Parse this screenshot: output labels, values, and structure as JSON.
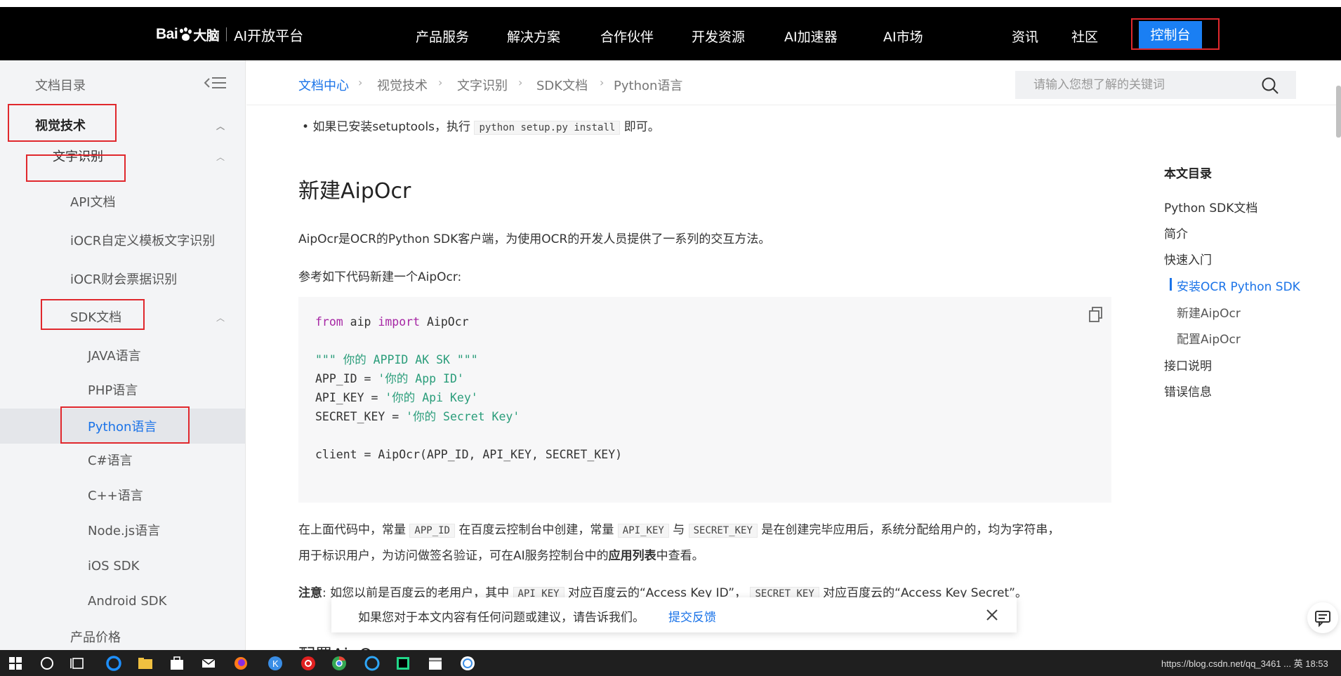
{
  "header": {
    "logo_text": "Bai",
    "logo_suffix": "大脑",
    "platform": "AI开放平台",
    "nav": [
      "产品服务",
      "解决方案",
      "合作伙伴",
      "开发资源",
      "AI加速器",
      "AI市场"
    ],
    "right_nav": [
      "资讯",
      "社区"
    ],
    "console_label": "控制台"
  },
  "sidebar": {
    "title": "文档目录",
    "items": [
      {
        "label": "视觉技术"
      },
      {
        "label": "文字识别"
      },
      {
        "label": "API文档"
      },
      {
        "label": "iOCR自定义模板文字识别"
      },
      {
        "label": "iOCR财会票据识别"
      },
      {
        "label": "SDK文档"
      },
      {
        "label": "JAVA语言"
      },
      {
        "label": "PHP语言"
      },
      {
        "label": "Python语言"
      },
      {
        "label": "C#语言"
      },
      {
        "label": "C++语言"
      },
      {
        "label": "Node.js语言"
      },
      {
        "label": "iOS SDK"
      },
      {
        "label": "Android SDK"
      },
      {
        "label": "产品价格"
      }
    ]
  },
  "breadcrumb": [
    "文档中心",
    "视觉技术",
    "文字识别",
    "SDK文档",
    "Python语言"
  ],
  "search": {
    "placeholder": "请输入您想了解的关键词"
  },
  "content": {
    "bullet_prefix": "如果已安装setuptools，执行",
    "bullet_code": "python setup.py install",
    "bullet_suffix": "即可。",
    "heading": "新建AipOcr",
    "intro": "AipOcr是OCR的Python SDK客户端，为使用OCR的开发人员提供了一系列的交互方法。",
    "ref": "参考如下代码新建一个AipOcr:",
    "code": {
      "l1_kw1": "from",
      "l1_mid": " aip ",
      "l1_kw2": "import",
      "l1_end": " AipOcr",
      "l3": "\"\"\" 你的 APPID AK SK \"\"\"",
      "l4_a": "APP_ID = ",
      "l4_b": "'你的 App ID'",
      "l5_a": "API_KEY = ",
      "l5_b": "'你的 Api Key'",
      "l6_a": "SECRET_KEY = ",
      "l6_b": "'你的 Secret Key'",
      "l8": "client = AipOcr(APP_ID, API_KEY, SECRET_KEY)"
    },
    "desc_1": "在上面代码中，常量",
    "desc_c1": "APP_ID",
    "desc_2": "在百度云控制台中创建，常量",
    "desc_c2": "API_KEY",
    "desc_3": "与",
    "desc_c3": "SECRET_KEY",
    "desc_4": "是在创建完毕应用后，系统分配给用户的，均为字符串，",
    "desc_line2_a": "用于标识用户，为访问做签名验证，可在AI服务控制台中的",
    "desc_line2_bold": "应用列表",
    "desc_line2_b": "中查看。",
    "note_label": "注意",
    "note_1": ": 如您以前是百度云的老用户，其中",
    "note_c1": "API_KEY",
    "note_2": "对应百度云的“Access Key ID”，",
    "note_c2": "SECRET_KEY",
    "note_3": "对应百度云的“Access Key Secret”。",
    "next_heading": "配置AipOcr"
  },
  "toc": {
    "title": "本文目录",
    "items": [
      {
        "label": "Python SDK文档"
      },
      {
        "label": "简介"
      },
      {
        "label": "快速入门"
      },
      {
        "label": "安装OCR Python SDK"
      },
      {
        "label": "新建AipOcr"
      },
      {
        "label": "配置AipOcr"
      },
      {
        "label": "接口说明"
      },
      {
        "label": "错误信息"
      }
    ]
  },
  "feedback": {
    "text": "如果您对于本文内容有任何问题或建议，请告诉我们。",
    "link": "提交反馈"
  },
  "taskbar": {
    "tray_text": "https://blog.csdn.net/qq_3461 ... 英 18:53"
  },
  "colors": {
    "accent": "#1a73e8",
    "nav_bg": "#000000",
    "console_btn": "#1a7ff3",
    "annotation": "#e0282d"
  }
}
